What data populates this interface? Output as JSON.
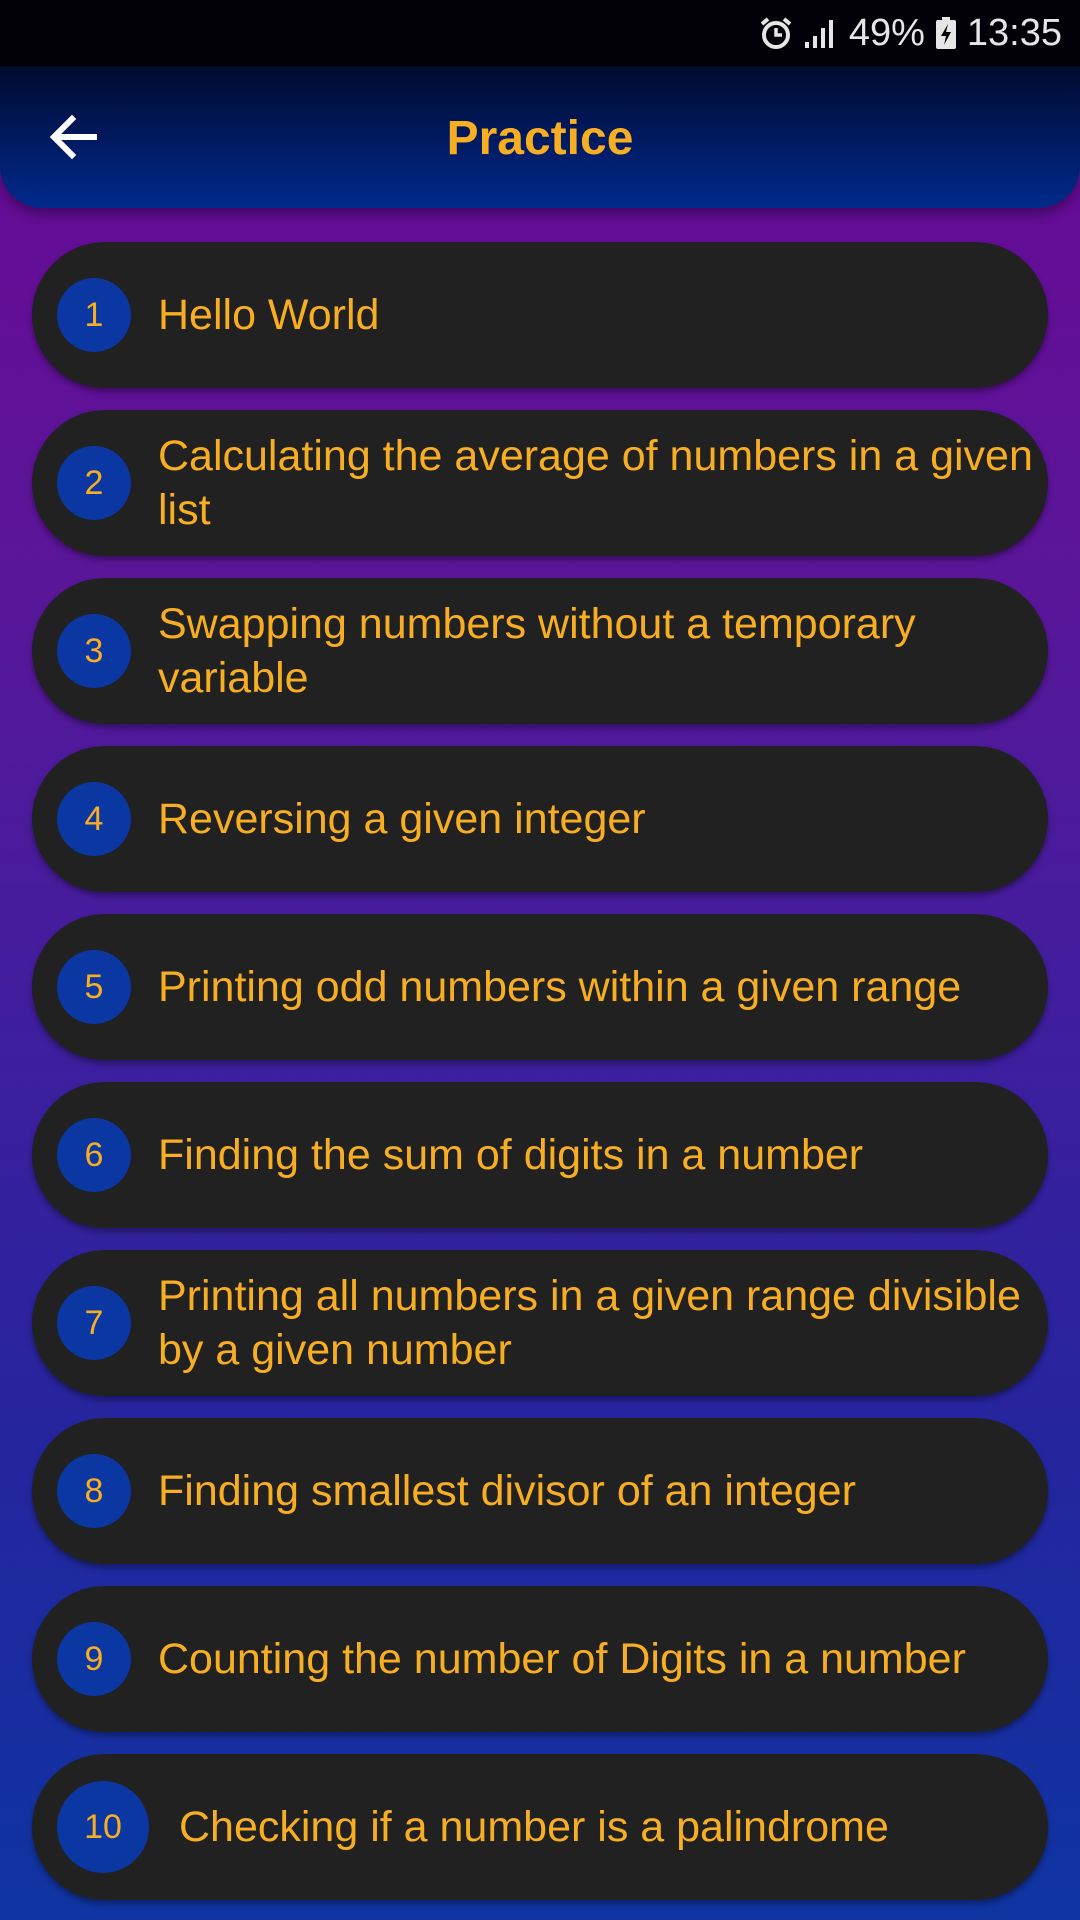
{
  "status_bar": {
    "alarm_icon": "alarm-icon",
    "signal_icon": "signal-icon",
    "battery_percent": "49%",
    "battery_icon": "battery-charging-icon",
    "time": "13:35"
  },
  "app_bar": {
    "back_icon": "arrow-back-icon",
    "title": "Practice"
  },
  "colors": {
    "accent": "#f8ae22",
    "card": "#212121",
    "badge": "#0a37a2"
  },
  "practice_items": [
    {
      "number": "1",
      "title": "Hello World"
    },
    {
      "number": "2",
      "title": "Calculating the average of numbers in a given list"
    },
    {
      "number": "3",
      "title": "Swapping numbers without a temporary variable"
    },
    {
      "number": "4",
      "title": "Reversing a given integer"
    },
    {
      "number": "5",
      "title": "Printing odd numbers within a given range"
    },
    {
      "number": "6",
      "title": "Finding the sum of digits in a number"
    },
    {
      "number": "7",
      "title": "Printing all numbers in a given range divisible by a given number"
    },
    {
      "number": "8",
      "title": "Finding smallest divisor of an integer"
    },
    {
      "number": "9",
      "title": "Counting the number of Digits in a number"
    },
    {
      "number": "10",
      "title": "Checking if a number is a palindrome"
    }
  ]
}
